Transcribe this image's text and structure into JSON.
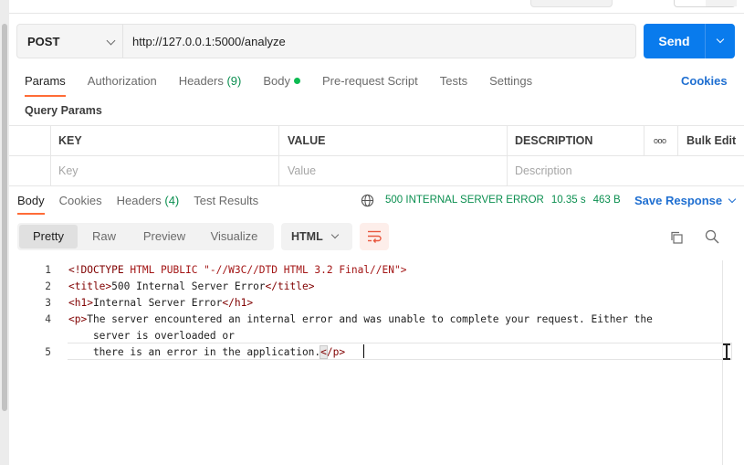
{
  "request": {
    "method": "POST",
    "url": "http://127.0.0.1:5000/analyze",
    "send_label": "Send"
  },
  "request_tabs": [
    {
      "label": "Params",
      "active": true
    },
    {
      "label": "Authorization"
    },
    {
      "label": "Headers",
      "count": "(9)"
    },
    {
      "label": "Body",
      "indicator": "green-dot"
    },
    {
      "label": "Pre-request Script"
    },
    {
      "label": "Tests"
    },
    {
      "label": "Settings"
    }
  ],
  "cookies_link": "Cookies",
  "query_params": {
    "title": "Query Params",
    "columns": [
      "KEY",
      "VALUE",
      "DESCRIPTION"
    ],
    "more_label": "ooo",
    "bulk_edit": "Bulk Edit",
    "placeholders": [
      "Key",
      "Value",
      "Description"
    ]
  },
  "response_tabs": [
    {
      "label": "Body",
      "active": true
    },
    {
      "label": "Cookies"
    },
    {
      "label": "Headers",
      "count": "(4)"
    },
    {
      "label": "Test Results"
    }
  ],
  "response_status": {
    "status": "500 INTERNAL SERVER ERROR",
    "time": "10.35 s",
    "size": "463 B",
    "save_label": "Save Response"
  },
  "view_modes": [
    "Pretty",
    "Raw",
    "Preview",
    "Visualize"
  ],
  "active_view": "Pretty",
  "format": "HTML",
  "code_lines": [
    {
      "n": "1",
      "text": "<!DOCTYPE HTML PUBLIC \"-//W3C//DTD HTML 3.2 Final//EN\">"
    },
    {
      "n": "2",
      "text": "<title>500 Internal Server Error</title>"
    },
    {
      "n": "3",
      "text": "<h1>Internal Server Error</h1>"
    },
    {
      "n": "4",
      "text": "<p>The server encountered an internal error and was unable to complete your request. Either the server is overloaded or there is an error in the application.</p>"
    },
    {
      "n": "5",
      "text": ""
    }
  ],
  "code_fragments": {
    "l1_tag": "<!DOCTYPE",
    "l1_rest": " HTML PUBLIC \"-//W3C//DTD HTML 3.2 Final//EN\">",
    "l2_open": "<title>",
    "l2_text": "500 Internal Server Error",
    "l2_close": "</title>",
    "l3_open": "<h1>",
    "l3_text": "Internal Server Error",
    "l3_close": "</h1>",
    "l4_open": "<p>",
    "l4_text": "The server encountered an internal error and was unable to complete your request. Either the",
    "l4_wrap": "    server is overloaded or",
    "l5_text": "    there is an error in the application.",
    "l5_close_lt": "<",
    "l5_close_rest": "/p>"
  },
  "icons": {
    "globe": "globe-icon",
    "wrap": "wrap-lines-icon",
    "copy": "copy-icon",
    "search": "search-icon"
  },
  "colors": {
    "send": "#097bed",
    "accent_tab": "#ff6c37",
    "status_green": "#0b8f50",
    "link_blue": "#1f6fd1"
  }
}
